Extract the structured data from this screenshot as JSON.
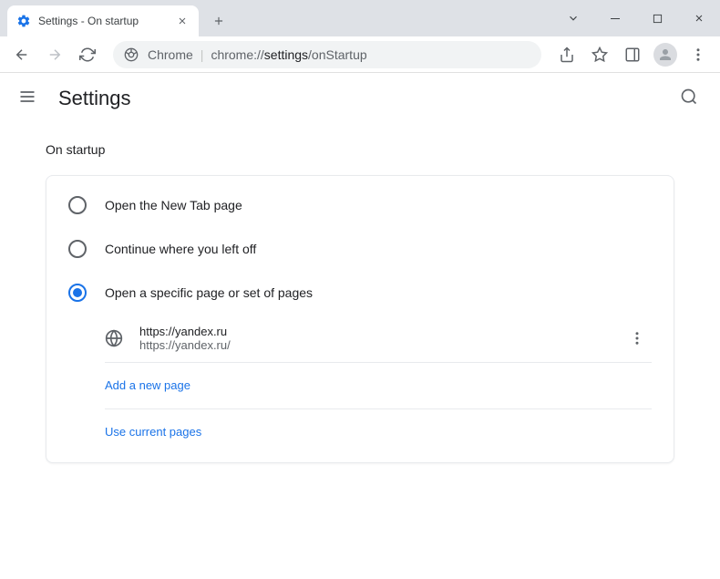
{
  "tab": {
    "title": "Settings - On startup"
  },
  "omnibox": {
    "prefix": "Chrome",
    "path_prefix": "chrome://",
    "path_bold": "settings",
    "path_suffix": "/onStartup"
  },
  "header": {
    "title": "Settings"
  },
  "section": {
    "title": "On startup",
    "options": [
      {
        "label": "Open the New Tab page",
        "selected": false
      },
      {
        "label": "Continue where you left off",
        "selected": false
      },
      {
        "label": "Open a specific page or set of pages",
        "selected": true
      }
    ],
    "pages": [
      {
        "title": "https://yandex.ru",
        "url": "https://yandex.ru/"
      }
    ],
    "add_page": "Add a new page",
    "use_current": "Use current pages"
  }
}
